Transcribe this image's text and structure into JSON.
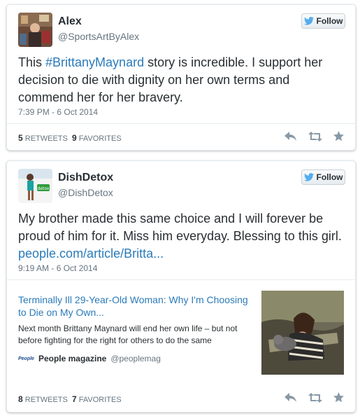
{
  "tweets": [
    {
      "name": "Alex",
      "handle": "@SportsArtByAlex",
      "follow_label": "Follow",
      "text_before": "This ",
      "hashtag": "#BrittanyMaynard",
      "text_after": " story is incredible. I support her decision to die with dignity on her own terms and commend her for her bravery.",
      "timestamp": "7:39 PM - 6 Oct 2014",
      "retweets_count": "5",
      "retweets_label": "RETWEETS",
      "favorites_count": "9",
      "favorites_label": "FAVORITES"
    },
    {
      "name": "DishDetox",
      "handle": "@DishDetox",
      "follow_label": "Follow",
      "text": "My brother made this same choice and I will forever be proud of him for it. Miss him everyday. Blessing to this girl. ",
      "link": "people.com/article/Britta...",
      "timestamp": "9:19 AM - 6 Oct 2014",
      "card": {
        "title": "Terminally Ill 29-Year-Old Woman: Why I'm Choosing to Die on My Own...",
        "description": "Next month Brittany Maynard will end her own life – but not before fighting for the right for others to do the same",
        "source_logo": "People",
        "source_name": "People magazine",
        "source_handle": "@peoplemag"
      },
      "retweets_count": "8",
      "retweets_label": "RETWEETS",
      "favorites_count": "7",
      "favorites_label": "FAVORITES"
    }
  ],
  "colors": {
    "link": "#2b7bb9",
    "text": "#292f33",
    "muted": "#66757f",
    "twitter_blue": "#55acee",
    "action_icon": "#8899a6"
  },
  "icons": {
    "bird": "twitter-bird-icon",
    "reply": "reply-icon",
    "retweet": "retweet-icon",
    "favorite": "favorite-star-icon"
  }
}
